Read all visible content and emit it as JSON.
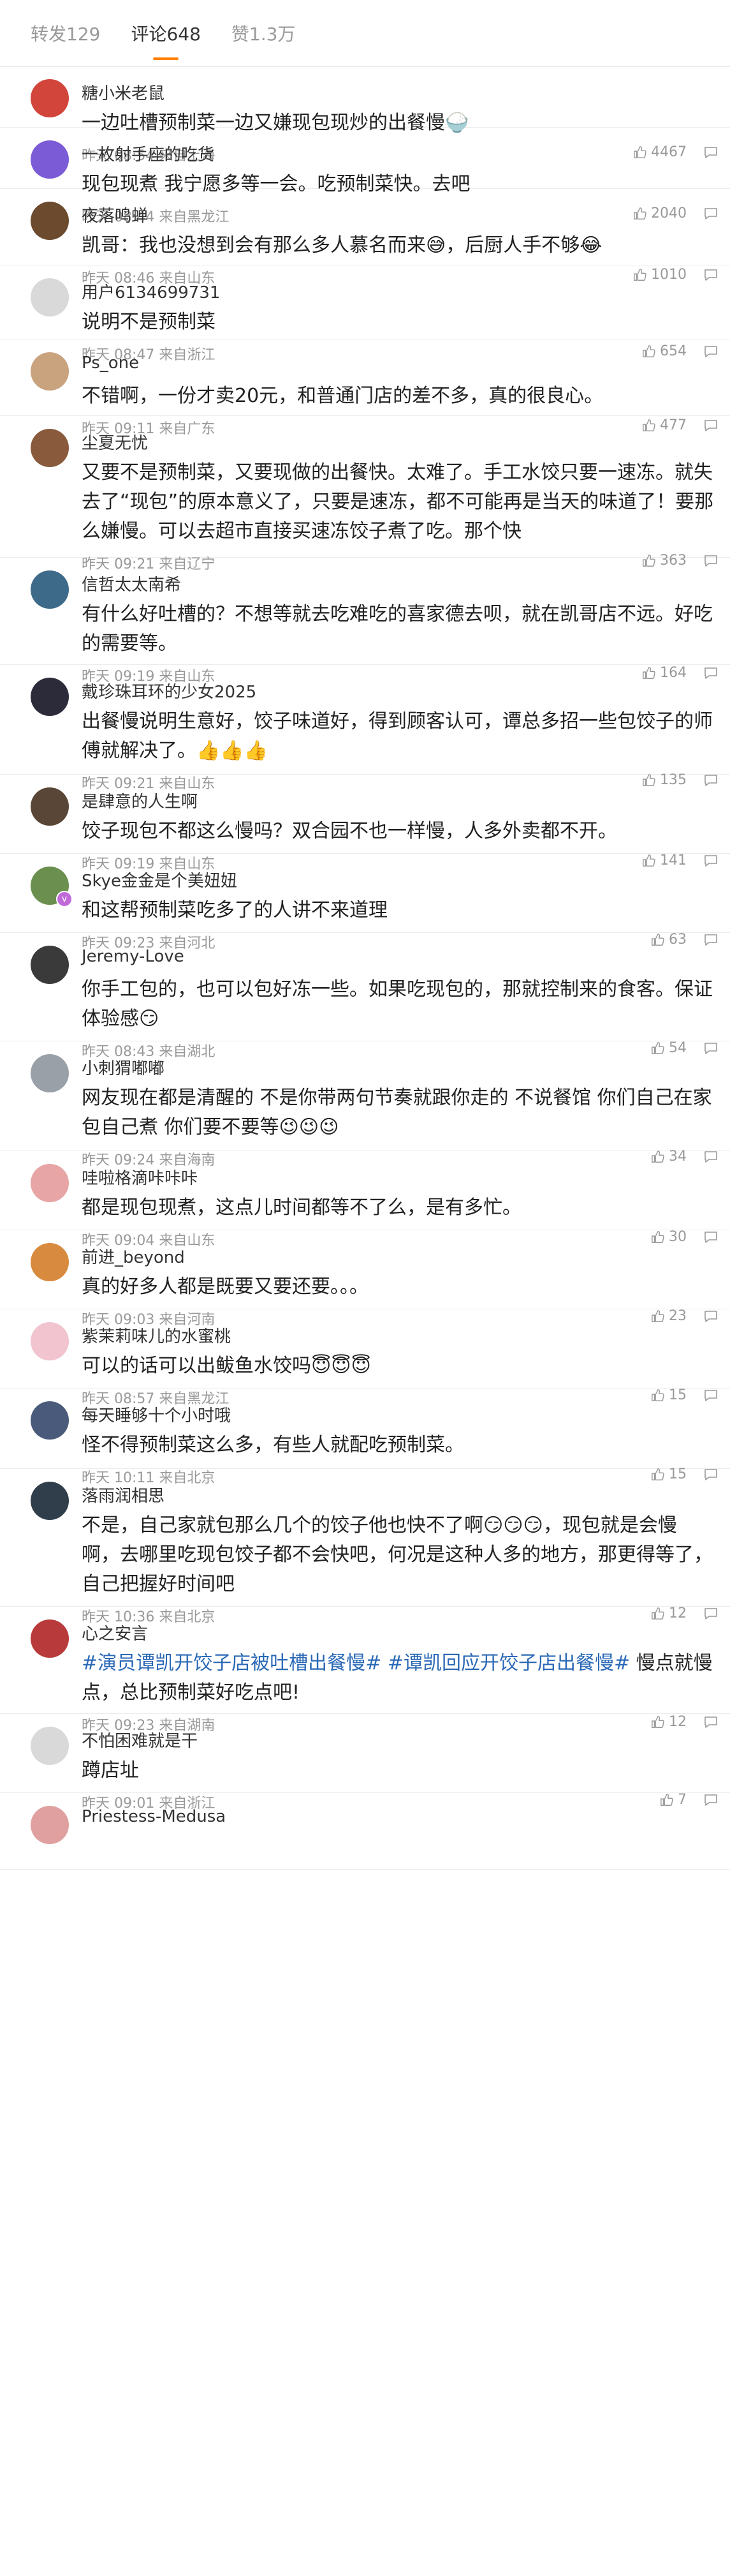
{
  "tabs": [
    {
      "label": "转发129"
    },
    {
      "label": "评论648"
    },
    {
      "label": "赞1.3万"
    }
  ],
  "comments": [
    {
      "name": "糖小米老鼠",
      "text": "一边吐槽预制菜一边又嫌现包现炒的出餐慢🍚",
      "time": "昨天 08:54 来自上海",
      "likes": "4467",
      "avatar_color": "#d1453b"
    },
    {
      "name": "一枚射手座的吃货",
      "text": "现包现煮 我宁愿多等一会。吃预制菜快。去吧",
      "time": "昨天 08:44 来自黑龙江",
      "likes": "2040",
      "avatar_color": "#7b5bd6"
    },
    {
      "name": "夜落鸣蝉",
      "text": "凯哥：我也没想到会有那么多人慕名而来😅，后厨人手不够😂",
      "time": "昨天 08:46 来自山东",
      "likes": "1010",
      "avatar_color": "#6b4a2e"
    },
    {
      "name": "用户6134699731",
      "text": "说明不是预制菜",
      "time": "昨天 08:47 来自浙江",
      "likes": "654",
      "avatar_color": "#d9d9d9"
    },
    {
      "name": "Ps_one",
      "text": "不错啊，一份才卖20元，和普通门店的差不多，真的很良心。",
      "time": "昨天 09:11 来自广东",
      "likes": "477",
      "avatar_color": "#c9a27e"
    },
    {
      "name": "尘夏无忧",
      "text": "又要不是预制菜，又要现做的出餐快。太难了。手工水饺只要一速冻。就失去了“现包”的原本意义了，只要是速冻，都不可能再是当天的味道了！要那么嫌慢。可以去超市直接买速冻饺子煮了吃。那个快",
      "time": "昨天 09:21 来自辽宁",
      "likes": "363",
      "avatar_color": "#8a5a3c"
    },
    {
      "name": "信哲太太南希",
      "text": "有什么好吐槽的？不想等就去吃难吃的喜家德去呗，就在凯哥店不远。好吃的需要等。",
      "time": "昨天 09:19 来自山东",
      "likes": "164",
      "avatar_color": "#3e6a8a"
    },
    {
      "name": "戴珍珠耳环的少女2025",
      "text": "出餐慢说明生意好，饺子味道好，得到顾客认可，谭总多招一些包饺子的师傅就解决了。👍👍👍",
      "time": "昨天 09:21 来自山东",
      "likes": "135",
      "avatar_color": "#2b2b3a"
    },
    {
      "name": "是肆意的人生啊",
      "text": "饺子现包不都这么慢吗？双合园不也一样慢，人多外卖都不开。",
      "time": "昨天 09:19 来自山东",
      "likes": "141",
      "avatar_color": "#5a4636"
    },
    {
      "name": "Skye金金是个美妞妞",
      "text": "和这帮预制菜吃多了的人讲不来道理",
      "time": "昨天 09:23 来自河北",
      "likes": "63",
      "avatar_color": "#6a8f4e"
    },
    {
      "name": "Jeremy-Love",
      "text": "你手工包的，也可以包好冻一些。如果吃现包的，那就控制来的食客。保证体验感😏",
      "time": "昨天 08:43 来自湖北",
      "likes": "54",
      "avatar_color": "#3a3a3a"
    },
    {
      "name": "小刺猬嘟嘟",
      "text": "网友现在都是清醒的 不是你带两句节奏就跟你走的 不说餐馆 你们自己在家包自己煮 你们要不要等😉😉😉",
      "time": "昨天 09:24 来自海南",
      "likes": "34",
      "avatar_color": "#9aa0a8"
    },
    {
      "name": "哇啦格滴咔咔咔",
      "text": "都是现包现煮，这点儿时间都等不了么，是有多忙。",
      "time": "昨天 09:04 来自山东",
      "likes": "30",
      "avatar_color": "#e7a5a5"
    },
    {
      "name": "前进_beyond",
      "text": "真的好多人都是既要又要还要。。。",
      "time": "昨天 09:03 来自河南",
      "likes": "23",
      "avatar_color": "#d88a3e"
    },
    {
      "name": "紫茉莉味儿的水蜜桃",
      "text": "可以的话可以出鲅鱼水饺吗😇😇😇",
      "time": "昨天 08:57 来自黑龙江",
      "likes": "15",
      "avatar_color": "#f1c4cf"
    },
    {
      "name": "每天睡够十个小时哦",
      "text": "怪不得预制菜这么多，有些人就配吃预制菜。",
      "time": "昨天 10:11 来自北京",
      "likes": "15",
      "avatar_color": "#4a5a7a"
    },
    {
      "name": "落雨润相思",
      "text": "不是，自己家就包那么几个的饺子他也快不了啊😏😏😏，现包就是会慢啊，去哪里吃现包饺子都不会快吧，何况是这种人多的地方，那更得等了，自己把握好时间吧",
      "time": "昨天 10:36 来自北京",
      "likes": "12",
      "avatar_color": "#2f3e4a"
    },
    {
      "name": "心之安言",
      "text_parts": [
        {
          "t": "#演员谭凯开饺子店被吐槽出餐慢#",
          "topic": true
        },
        {
          "t": " ",
          "topic": false
        },
        {
          "t": "#谭凯回应开饺子店出餐慢#",
          "topic": true
        },
        {
          "t": " 慢点就慢点，总比预制菜好吃点吧!",
          "topic": false
        }
      ],
      "time": "昨天 09:23 来自湖南",
      "likes": "12",
      "avatar_color": "#b83a3a"
    },
    {
      "name": "不怕困难就是干",
      "text": "蹲店址",
      "time": "昨天 09:01 来自浙江",
      "likes": "7",
      "avatar_color": "#d9d9d9"
    },
    {
      "name": "Priestess-Medusa",
      "text": "",
      "time": "",
      "likes": "",
      "avatar_color": "#e0a0a0"
    }
  ],
  "colors": {
    "topic": "#2a68b6",
    "tab_indicator": "#ff8200"
  }
}
